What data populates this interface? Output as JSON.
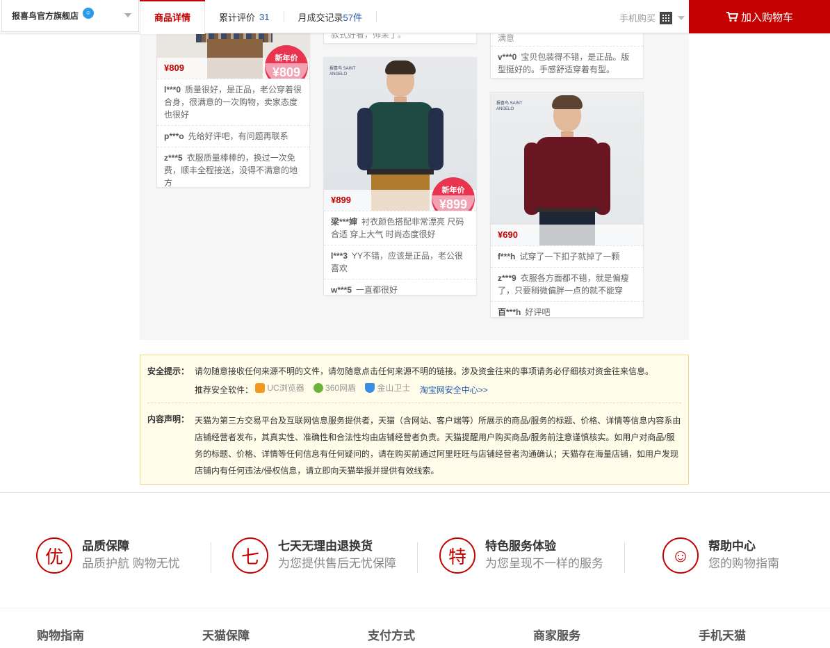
{
  "topbar": {
    "shop_name": "报喜鸟官方旗舰店",
    "tabs": {
      "detail": "商品详情",
      "reviews_label": "累计评价",
      "reviews_count": "31",
      "sales_label": "月成交记录",
      "sales_count": "57件"
    },
    "mobile_buy": "手机购买",
    "add_to_cart": "加入购物车"
  },
  "cards": {
    "c1": {
      "price": "¥809",
      "promo_label": "新年价",
      "promo_price": "¥809",
      "reviews": [
        {
          "user": "l***0",
          "text": "质量很好，是正品，老公穿着很合身，很满意的一次购物，卖家态度也很好"
        },
        {
          "user": "p***o",
          "text": "先给好评吧，有问题再联系"
        },
        {
          "user": "z***5",
          "text": "衣服质量棒棒的，换过一次免费，顺丰全程接送，没得不满意的地方"
        }
      ]
    },
    "c2_top_fragment": "款式好看，帅呆了。",
    "c2": {
      "brand": "报喜鸟 SAINT ANGELO",
      "price": "¥899",
      "promo_label": "新年价",
      "promo_price": "¥899",
      "reviews": [
        {
          "user": "梁***婶",
          "text": "衬衣颜色搭配非常漂亮 尺码合适 穿上大气 时尚态度很好"
        },
        {
          "user": "l***3",
          "text": "YY不错，应该是正品，老公很喜欢"
        },
        {
          "user": "w***5",
          "text": "一直都很好"
        }
      ]
    },
    "c3_top_fragment": "满意",
    "c3_top_review": {
      "user": "v***0",
      "text": "宝贝包装得不错，是正品。版型挺好的。手感舒适穿着有型。"
    },
    "c4": {
      "brand": "报喜鸟 SAINT ANGELO",
      "price": "¥690",
      "reviews": [
        {
          "user": "f***h",
          "text": "试穿了一下扣子就掉了一颗"
        },
        {
          "user": "z***9",
          "text": "衣服各方面都不错，就是偏瘦了，只要稍微偏胖一点的就不能穿"
        },
        {
          "user": "百***h",
          "text": "好评吧"
        }
      ]
    }
  },
  "notice": {
    "safety_label": "安全提示：",
    "safety_text": "请勿随意接收任何来源不明的文件，请勿随意点击任何来源不明的链接。涉及资金往来的事项请务必仔细核对资金往来信息。",
    "recommend_label": "推荐安全软件：",
    "software": [
      "UC浏览器",
      "360网盾",
      "金山卫士"
    ],
    "center_link": "淘宝网安全中心>>",
    "content_label": "内容声明：",
    "content_text": "天猫为第三方交易平台及互联网信息服务提供者，天猫（含网站、客户端等）所展示的商品/服务的标题、价格、详情等信息内容系由店铺经营者发布，其真实性、准确性和合法性均由店铺经营者负责。天猫提醒用户购买商品/服务前注意谨慎核实。如用户对商品/服务的标题、价格、详情等任何信息有任何疑问的，请在购买前通过阿里旺旺与店铺经营者沟通确认；天猫存在海量店铺，如用户发现店铺内有任何违法/侵权信息，请立即向天猫举报并提供有效线索。"
  },
  "services": [
    {
      "icon": "优",
      "title": "品质保障",
      "sub": "品质护航 购物无忧"
    },
    {
      "icon": "七",
      "title": "七天无理由退换货",
      "sub": "为您提供售后无忧保障"
    },
    {
      "icon": "特",
      "title": "特色服务体验",
      "sub": "为您呈现不一样的服务"
    },
    {
      "icon": "☺",
      "title": "帮助中心",
      "sub": "您的购物指南"
    }
  ],
  "footer_cols": [
    "购物指南",
    "天猫保障",
    "支付方式",
    "商家服务",
    "手机天猫"
  ],
  "colors": {
    "accent": "#c40000",
    "link": "#2053a5",
    "notice_bg": "#fffdea"
  }
}
